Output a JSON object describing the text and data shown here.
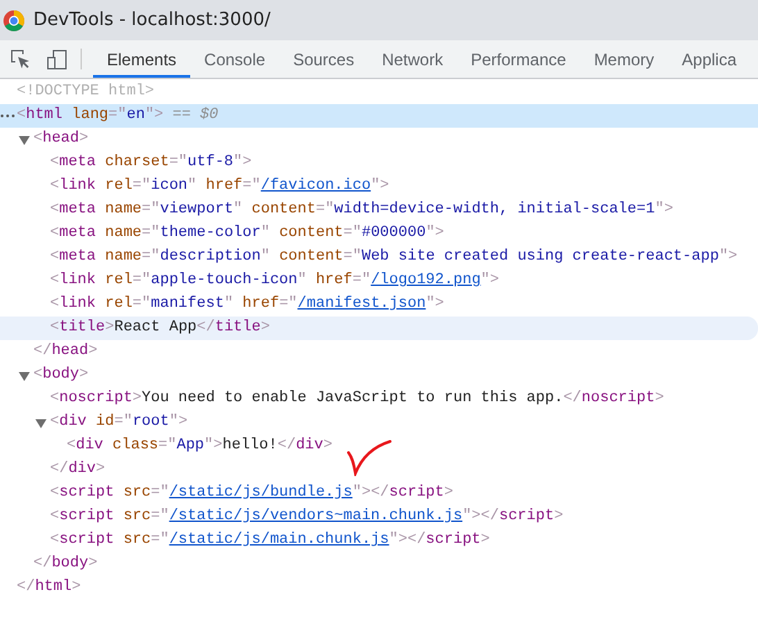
{
  "window": {
    "title": "DevTools - localhost:3000/"
  },
  "tabs": [
    {
      "label": "Elements",
      "selected": true
    },
    {
      "label": "Console",
      "selected": false
    },
    {
      "label": "Sources",
      "selected": false
    },
    {
      "label": "Network",
      "selected": false
    },
    {
      "label": "Performance",
      "selected": false
    },
    {
      "label": "Memory",
      "selected": false
    },
    {
      "label": "Applica",
      "selected": false
    }
  ],
  "dom_tree": [
    {
      "tokens": [
        {
          "kind": "doctype",
          "text": "<!DOCTYPE html>"
        }
      ],
      "selected": false,
      "hovered": false
    },
    {
      "tokens": [
        {
          "kind": "punct",
          "text": "<"
        },
        {
          "kind": "tag",
          "text": "html"
        },
        {
          "kind": "attr",
          "text": " lang"
        },
        {
          "kind": "punct",
          "text": "=\""
        },
        {
          "kind": "value",
          "text": "en"
        },
        {
          "kind": "punct",
          "text": "\">"
        },
        {
          "kind": "ref",
          "text": " == $0"
        }
      ],
      "selected": true,
      "hovered": false,
      "children": [
        {
          "tokens": [
            {
              "kind": "punct",
              "text": "<"
            },
            {
              "kind": "tag",
              "text": "head"
            },
            {
              "kind": "punct",
              "text": ">"
            }
          ],
          "selected": false,
          "hovered": false,
          "expanded": true,
          "children": [
            {
              "tokens": [
                {
                  "kind": "punct",
                  "text": "<"
                },
                {
                  "kind": "tag",
                  "text": "meta"
                },
                {
                  "kind": "attr",
                  "text": " charset"
                },
                {
                  "kind": "punct",
                  "text": "=\""
                },
                {
                  "kind": "value",
                  "text": "utf-8"
                },
                {
                  "kind": "punct",
                  "text": "\">"
                }
              ],
              "selected": false,
              "hovered": false
            },
            {
              "tokens": [
                {
                  "kind": "punct",
                  "text": "<"
                },
                {
                  "kind": "tag",
                  "text": "link"
                },
                {
                  "kind": "attr",
                  "text": " rel"
                },
                {
                  "kind": "punct",
                  "text": "=\""
                },
                {
                  "kind": "value",
                  "text": "icon"
                },
                {
                  "kind": "punct",
                  "text": "\""
                },
                {
                  "kind": "attr",
                  "text": " href"
                },
                {
                  "kind": "punct",
                  "text": "=\""
                },
                {
                  "kind": "link",
                  "text": "/favicon.ico"
                },
                {
                  "kind": "punct",
                  "text": "\">"
                }
              ],
              "selected": false,
              "hovered": false
            },
            {
              "tokens": [
                {
                  "kind": "punct",
                  "text": "<"
                },
                {
                  "kind": "tag",
                  "text": "meta"
                },
                {
                  "kind": "attr",
                  "text": " name"
                },
                {
                  "kind": "punct",
                  "text": "=\""
                },
                {
                  "kind": "value",
                  "text": "viewport"
                },
                {
                  "kind": "punct",
                  "text": "\""
                },
                {
                  "kind": "attr",
                  "text": " content"
                },
                {
                  "kind": "punct",
                  "text": "=\""
                },
                {
                  "kind": "value",
                  "text": "width=device-width, initial-scale=1"
                },
                {
                  "kind": "punct",
                  "text": "\">"
                }
              ],
              "selected": false,
              "hovered": false
            },
            {
              "tokens": [
                {
                  "kind": "punct",
                  "text": "<"
                },
                {
                  "kind": "tag",
                  "text": "meta"
                },
                {
                  "kind": "attr",
                  "text": " name"
                },
                {
                  "kind": "punct",
                  "text": "=\""
                },
                {
                  "kind": "value",
                  "text": "theme-color"
                },
                {
                  "kind": "punct",
                  "text": "\""
                },
                {
                  "kind": "attr",
                  "text": " content"
                },
                {
                  "kind": "punct",
                  "text": "=\""
                },
                {
                  "kind": "value",
                  "text": "#000000"
                },
                {
                  "kind": "punct",
                  "text": "\">"
                }
              ],
              "selected": false,
              "hovered": false
            },
            {
              "tokens": [
                {
                  "kind": "punct",
                  "text": "<"
                },
                {
                  "kind": "tag",
                  "text": "meta"
                },
                {
                  "kind": "attr",
                  "text": " name"
                },
                {
                  "kind": "punct",
                  "text": "=\""
                },
                {
                  "kind": "value",
                  "text": "description"
                },
                {
                  "kind": "punct",
                  "text": "\""
                },
                {
                  "kind": "attr",
                  "text": " content"
                },
                {
                  "kind": "punct",
                  "text": "=\""
                },
                {
                  "kind": "value",
                  "text": "Web site created using create-react-app"
                },
                {
                  "kind": "punct",
                  "text": "\">"
                }
              ],
              "selected": false,
              "hovered": false
            },
            {
              "tokens": [
                {
                  "kind": "punct",
                  "text": "<"
                },
                {
                  "kind": "tag",
                  "text": "link"
                },
                {
                  "kind": "attr",
                  "text": " rel"
                },
                {
                  "kind": "punct",
                  "text": "=\""
                },
                {
                  "kind": "value",
                  "text": "apple-touch-icon"
                },
                {
                  "kind": "punct",
                  "text": "\""
                },
                {
                  "kind": "attr",
                  "text": " href"
                },
                {
                  "kind": "punct",
                  "text": "=\""
                },
                {
                  "kind": "link",
                  "text": "/logo192.png"
                },
                {
                  "kind": "punct",
                  "text": "\">"
                }
              ],
              "selected": false,
              "hovered": false
            },
            {
              "tokens": [
                {
                  "kind": "punct",
                  "text": "<"
                },
                {
                  "kind": "tag",
                  "text": "link"
                },
                {
                  "kind": "attr",
                  "text": " rel"
                },
                {
                  "kind": "punct",
                  "text": "=\""
                },
                {
                  "kind": "value",
                  "text": "manifest"
                },
                {
                  "kind": "punct",
                  "text": "\""
                },
                {
                  "kind": "attr",
                  "text": " href"
                },
                {
                  "kind": "punct",
                  "text": "=\""
                },
                {
                  "kind": "link",
                  "text": "/manifest.json"
                },
                {
                  "kind": "punct",
                  "text": "\">"
                }
              ],
              "selected": false,
              "hovered": false
            },
            {
              "tokens": [
                {
                  "kind": "punct",
                  "text": "<"
                },
                {
                  "kind": "tag",
                  "text": "title"
                },
                {
                  "kind": "punct",
                  "text": ">"
                },
                {
                  "kind": "text",
                  "text": "React App"
                },
                {
                  "kind": "punct",
                  "text": "</"
                },
                {
                  "kind": "tag",
                  "text": "title"
                },
                {
                  "kind": "punct",
                  "text": ">"
                }
              ],
              "selected": false,
              "hovered": true
            }
          ]
        },
        {
          "tokens": [
            {
              "kind": "punct",
              "text": "</"
            },
            {
              "kind": "tag",
              "text": "head"
            },
            {
              "kind": "punct",
              "text": ">"
            }
          ],
          "selected": false,
          "hovered": false
        },
        {
          "tokens": [
            {
              "kind": "punct",
              "text": "<"
            },
            {
              "kind": "tag",
              "text": "body"
            },
            {
              "kind": "punct",
              "text": ">"
            }
          ],
          "selected": false,
          "hovered": false,
          "expanded": true,
          "children": [
            {
              "tokens": [
                {
                  "kind": "punct",
                  "text": "<"
                },
                {
                  "kind": "tag",
                  "text": "noscript"
                },
                {
                  "kind": "punct",
                  "text": ">"
                },
                {
                  "kind": "text",
                  "text": "You need to enable JavaScript to run this app."
                },
                {
                  "kind": "punct",
                  "text": "</"
                },
                {
                  "kind": "tag",
                  "text": "noscript"
                },
                {
                  "kind": "punct",
                  "text": ">"
                }
              ],
              "selected": false,
              "hovered": false
            },
            {
              "tokens": [
                {
                  "kind": "punct",
                  "text": "<"
                },
                {
                  "kind": "tag",
                  "text": "div"
                },
                {
                  "kind": "attr",
                  "text": " id"
                },
                {
                  "kind": "punct",
                  "text": "=\""
                },
                {
                  "kind": "value",
                  "text": "root"
                },
                {
                  "kind": "punct",
                  "text": "\">"
                }
              ],
              "selected": false,
              "hovered": false,
              "expanded": true,
              "children": [
                {
                  "tokens": [
                    {
                      "kind": "punct",
                      "text": "<"
                    },
                    {
                      "kind": "tag",
                      "text": "div"
                    },
                    {
                      "kind": "attr",
                      "text": " class"
                    },
                    {
                      "kind": "punct",
                      "text": "=\""
                    },
                    {
                      "kind": "value",
                      "text": "App"
                    },
                    {
                      "kind": "punct",
                      "text": "\">"
                    },
                    {
                      "kind": "text",
                      "text": "hello!"
                    },
                    {
                      "kind": "punct",
                      "text": "</"
                    },
                    {
                      "kind": "tag",
                      "text": "div"
                    },
                    {
                      "kind": "punct",
                      "text": ">"
                    }
                  ],
                  "selected": false,
                  "hovered": false,
                  "checked_off": true
                }
              ]
            },
            {
              "tokens": [
                {
                  "kind": "punct",
                  "text": "</"
                },
                {
                  "kind": "tag",
                  "text": "div"
                },
                {
                  "kind": "punct",
                  "text": ">"
                }
              ],
              "selected": false,
              "hovered": false
            },
            {
              "tokens": [
                {
                  "kind": "punct",
                  "text": "<"
                },
                {
                  "kind": "tag",
                  "text": "script"
                },
                {
                  "kind": "attr",
                  "text": " src"
                },
                {
                  "kind": "punct",
                  "text": "=\""
                },
                {
                  "kind": "link",
                  "text": "/static/js/bundle.js"
                },
                {
                  "kind": "punct",
                  "text": "\">"
                },
                {
                  "kind": "punct",
                  "text": "</"
                },
                {
                  "kind": "tag",
                  "text": "script"
                },
                {
                  "kind": "punct",
                  "text": ">"
                }
              ],
              "selected": false,
              "hovered": false
            },
            {
              "tokens": [
                {
                  "kind": "punct",
                  "text": "<"
                },
                {
                  "kind": "tag",
                  "text": "script"
                },
                {
                  "kind": "attr",
                  "text": " src"
                },
                {
                  "kind": "punct",
                  "text": "=\""
                },
                {
                  "kind": "link",
                  "text": "/static/js/vendors~main.chunk.js"
                },
                {
                  "kind": "punct",
                  "text": "\">"
                },
                {
                  "kind": "punct",
                  "text": "</"
                },
                {
                  "kind": "tag",
                  "text": "script"
                },
                {
                  "kind": "punct",
                  "text": ">"
                }
              ],
              "selected": false,
              "hovered": false
            },
            {
              "tokens": [
                {
                  "kind": "punct",
                  "text": "<"
                },
                {
                  "kind": "tag",
                  "text": "script"
                },
                {
                  "kind": "attr",
                  "text": " src"
                },
                {
                  "kind": "punct",
                  "text": "=\""
                },
                {
                  "kind": "link",
                  "text": "/static/js/main.chunk.js"
                },
                {
                  "kind": "punct",
                  "text": "\">"
                },
                {
                  "kind": "punct",
                  "text": "</"
                },
                {
                  "kind": "tag",
                  "text": "script"
                },
                {
                  "kind": "punct",
                  "text": ">"
                }
              ],
              "selected": false,
              "hovered": false
            }
          ]
        },
        {
          "tokens": [
            {
              "kind": "punct",
              "text": "</"
            },
            {
              "kind": "tag",
              "text": "body"
            },
            {
              "kind": "punct",
              "text": ">"
            }
          ],
          "selected": false,
          "hovered": false
        }
      ]
    },
    {
      "tokens": [
        {
          "kind": "punct",
          "text": "</"
        },
        {
          "kind": "tag",
          "text": "html"
        },
        {
          "kind": "punct",
          "text": ">"
        }
      ],
      "selected": false,
      "hovered": false
    }
  ]
}
